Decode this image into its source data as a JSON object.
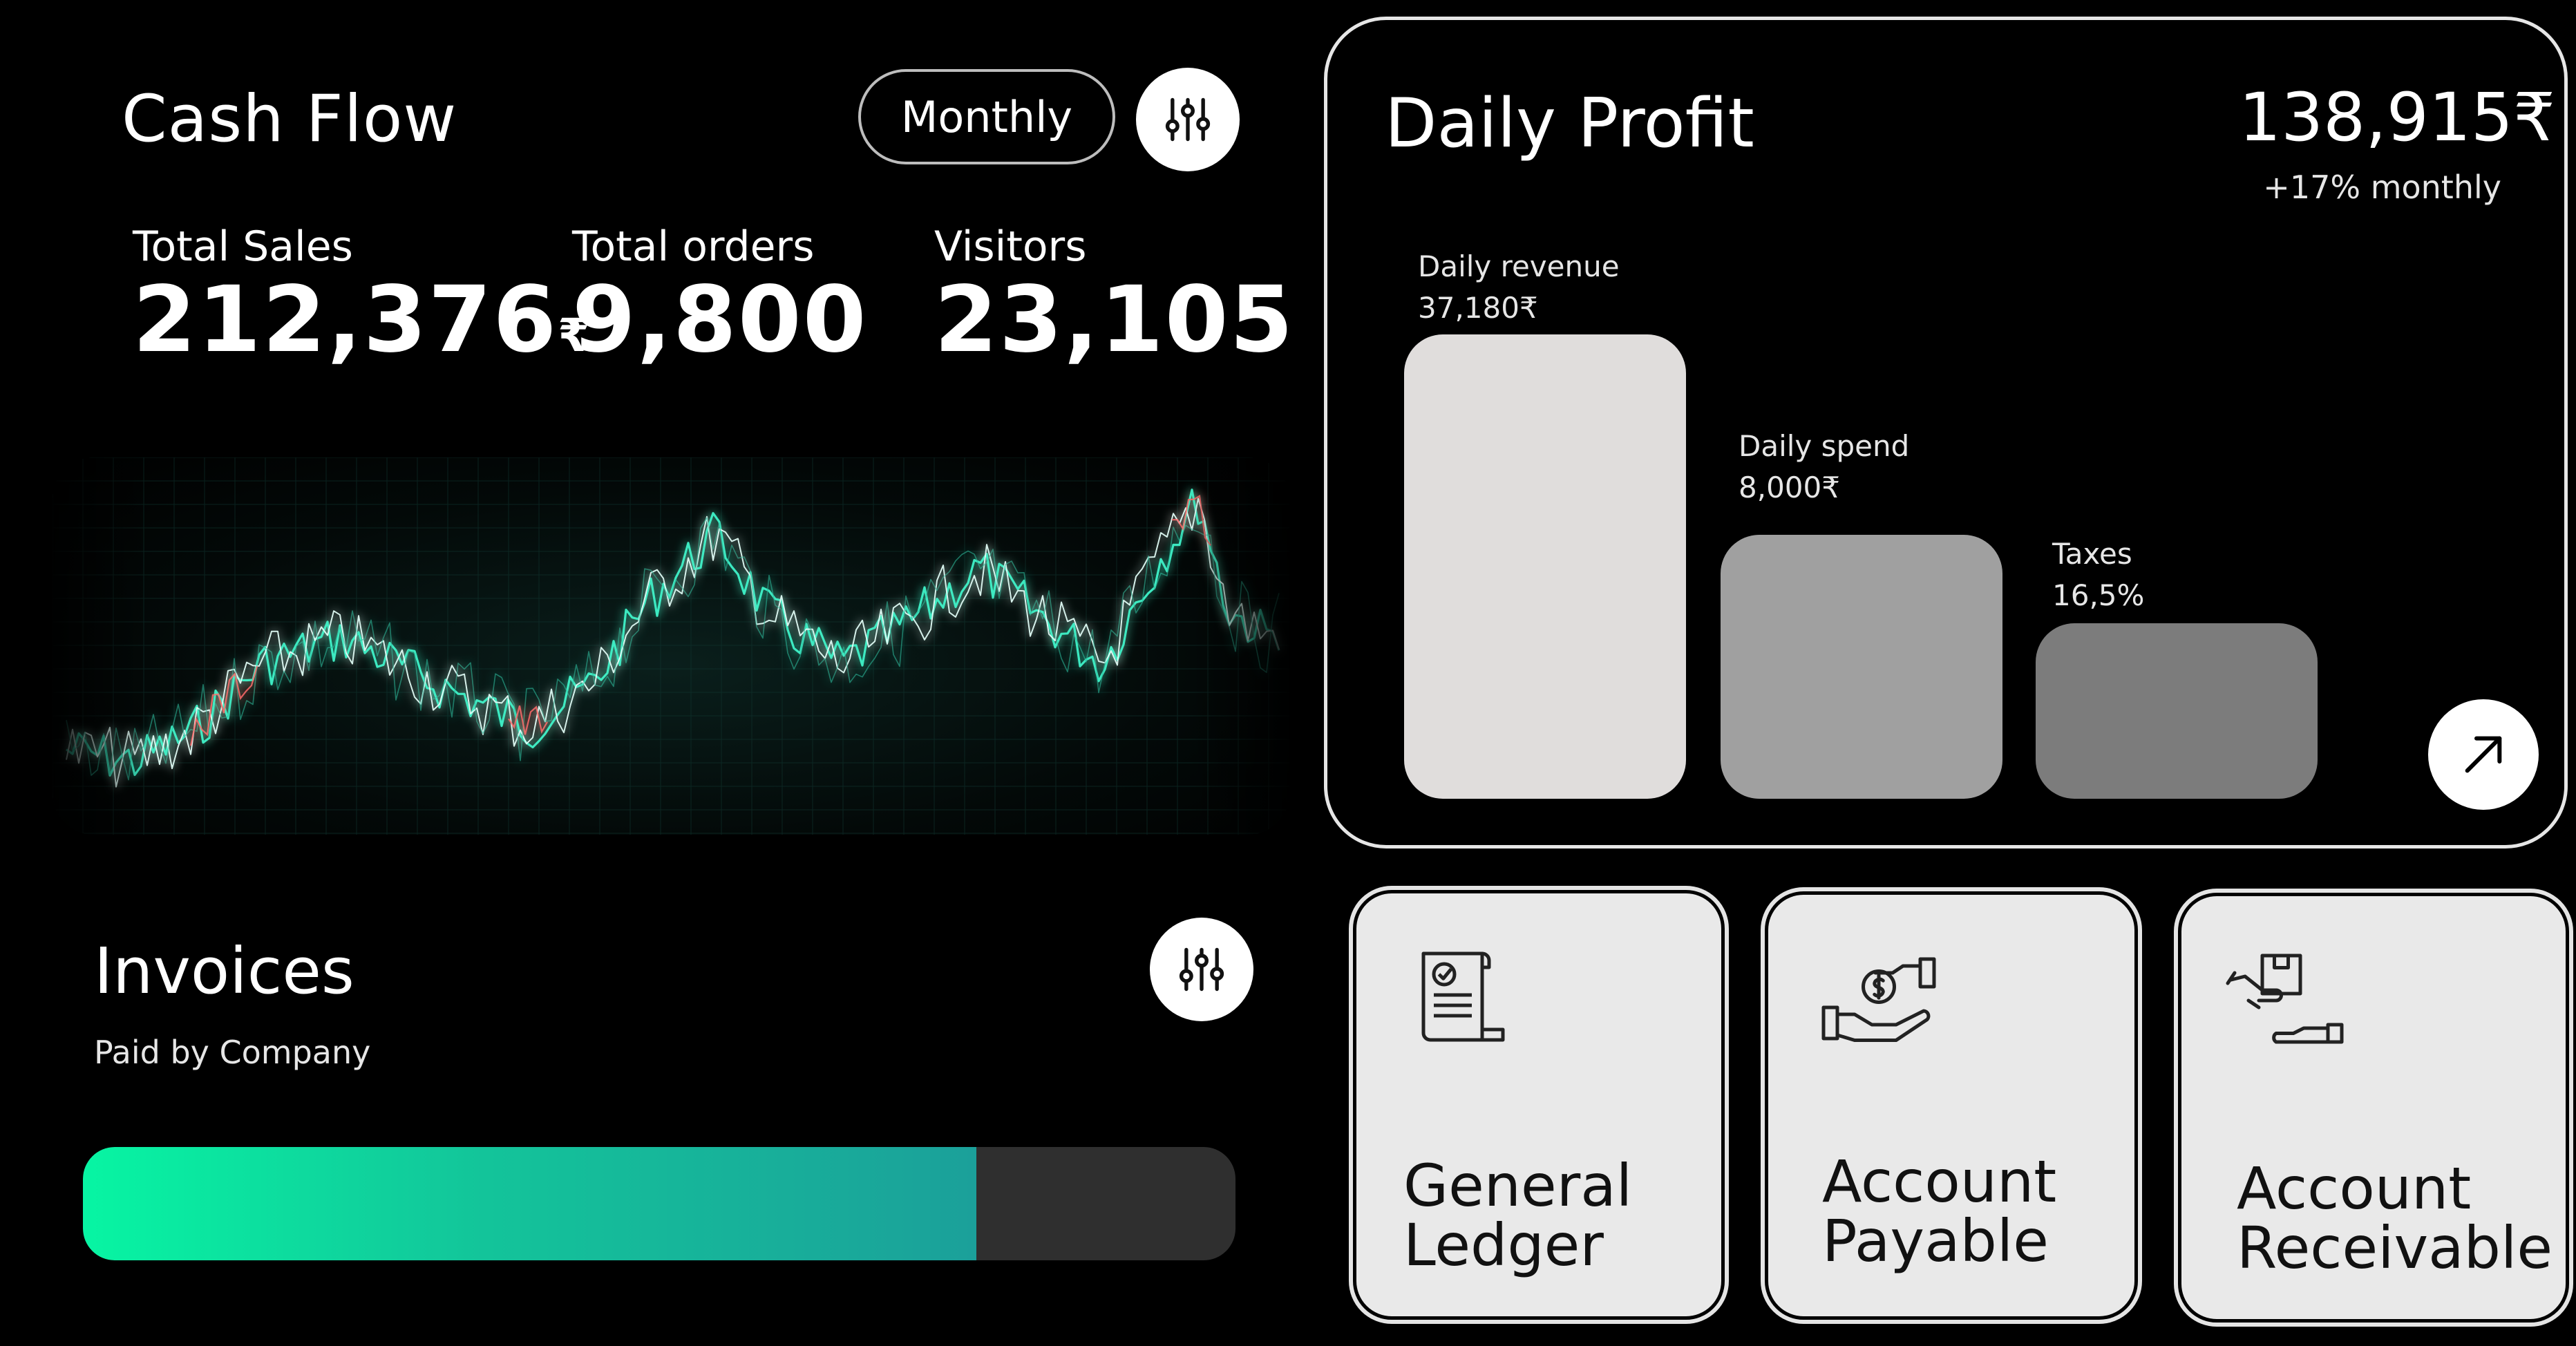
{
  "cash_flow": {
    "title": "Cash Flow",
    "period_button": "Monthly",
    "filter_icon": "sliders-icon",
    "stats": [
      {
        "label": "Total Sales",
        "value": "212,376",
        "currency": "₹"
      },
      {
        "label": "Total orders",
        "value": "9,800",
        "currency": ""
      },
      {
        "label": "Visitors",
        "value": "23,105",
        "currency": ""
      }
    ]
  },
  "invoices": {
    "title": "Invoices",
    "subtitle": "Paid by Company",
    "filter_icon": "sliders-icon",
    "paid_fraction": 0.775
  },
  "daily_profit": {
    "title": "Daily Profit",
    "total": "138,915₹",
    "growth": "+17% monthly",
    "bars": [
      {
        "label": "Daily revenue",
        "value": "37,180₹",
        "color": "#e0dddc"
      },
      {
        "label": "Daily spend",
        "value": "8,000₹",
        "color": "#a0a0a0"
      },
      {
        "label": "Taxes",
        "value": "16,5%",
        "color": "#7c7c7c"
      }
    ],
    "arrow_icon": "arrow-up-right-icon"
  },
  "tiles": [
    {
      "line1": "General",
      "line2": "Ledger",
      "icon": "ledger-document-icon"
    },
    {
      "line1": "Account",
      "line2": "Payable",
      "icon": "hand-dollar-icon"
    },
    {
      "line1": "Account",
      "line2": "Receivable",
      "icon": "package-handover-icon"
    }
  ],
  "colors": {
    "background": "#000000",
    "accent_start": "#07f5a3",
    "accent_end": "#1ba09a",
    "tile_bg": "#e9e9e9"
  }
}
